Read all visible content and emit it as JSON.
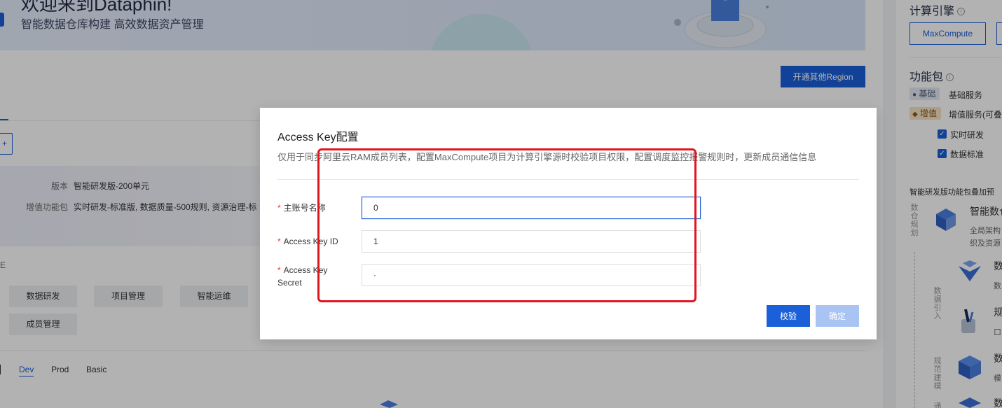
{
  "banner": {
    "title": "欢迎来到Dataphin!",
    "subtitle": "智能数据仓库构建 高效数据资产管理"
  },
  "page": {
    "region_button": "开通其他Region",
    "mini_button": "+",
    "version_label": "版本",
    "version_value": "智能研发版-200单元",
    "addon_label": "增值功能包",
    "addon_value": "实时研发-标准版, 数据质量-500规则, 资源治理-标",
    "modules_marker": "E",
    "modules": [
      "数据研发",
      "项目管理",
      "智能运维",
      "成员管理"
    ],
    "env_tabs": [
      "Dev",
      "Prod",
      "Basic"
    ],
    "env_active": "Dev"
  },
  "right_panel": {
    "engine_title": "计算引擎",
    "engine_button": "MaxCompute",
    "package_title": "功能包",
    "packages": [
      {
        "tag": "基础",
        "name": "基础服务"
      },
      {
        "tag": "增值",
        "name": "增值服务(可叠"
      }
    ],
    "checkboxes": [
      "实时研发",
      "数据标准"
    ],
    "feature_title": "智能研发版功能包叠加预",
    "vertical_groups": [
      "数仓规划",
      "数据引入",
      "规范建模",
      "通"
    ],
    "items": [
      {
        "title": "智能数仓",
        "line1": "全局架构",
        "line2": "织及资源"
      },
      {
        "title": "数",
        "line1": "数"
      },
      {
        "title": "规",
        "line1": "口"
      },
      {
        "title": "数",
        "line1": "模"
      },
      {
        "title": "数"
      }
    ],
    "colors": {
      "accent": "#1b5fd9",
      "value_tag": "#f5e3c8",
      "base_tag": "#e4e9f2"
    }
  },
  "modal": {
    "title": "Access Key配置",
    "description": "仅用于同步阿里云RAM成员列表，配置MaxCompute项目为计算引擎源时校验项目权限，配置调度监控报警规则时，更新成员通信信息",
    "fields": [
      {
        "label": "主账号名称",
        "value": "0",
        "required": true
      },
      {
        "label": "Access Key ID",
        "value": "1",
        "required": true
      },
      {
        "label_line1": "Access Key",
        "label_line2": "Secret",
        "value": "·",
        "required": true
      }
    ],
    "required_mark": "*",
    "verify_button": "校验",
    "ok_button": "确定"
  }
}
